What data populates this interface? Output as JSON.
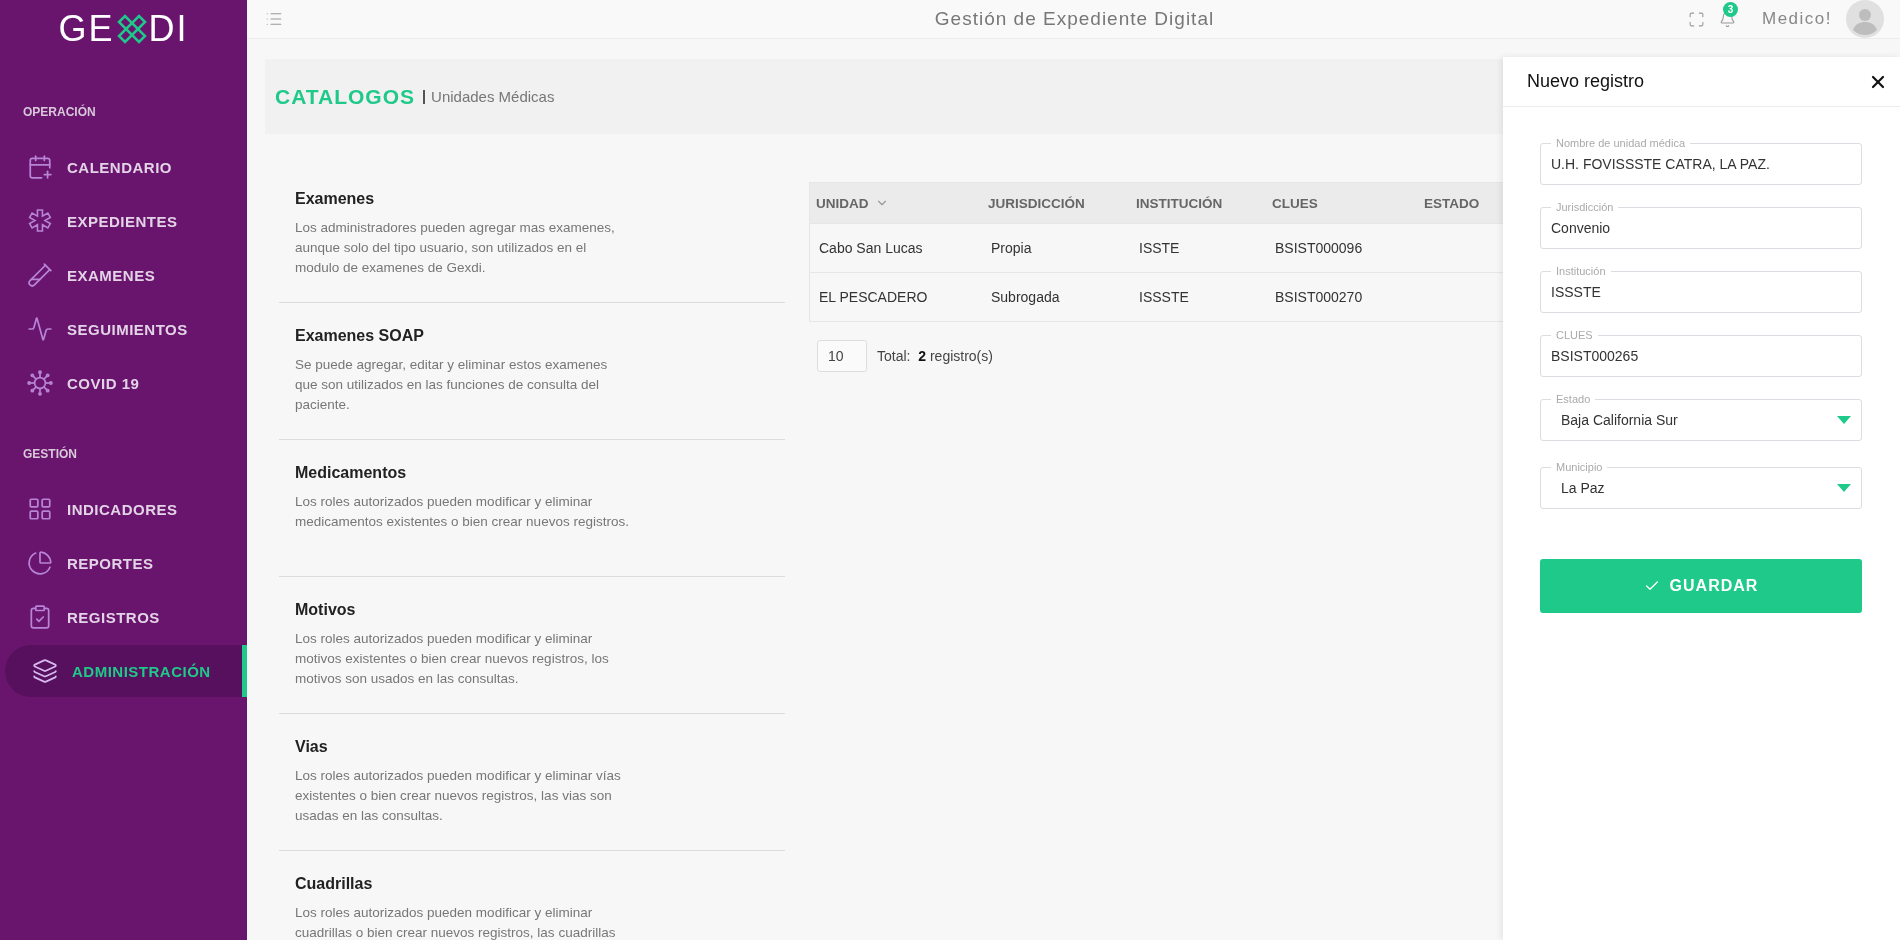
{
  "logo": {
    "left": "GE",
    "right": "DI"
  },
  "sidebar": {
    "sections": [
      {
        "title": "OPERACIÓN",
        "items": [
          {
            "label": "CALENDARIO",
            "selected": false
          },
          {
            "label": "EXPEDIENTES",
            "selected": false
          },
          {
            "label": "EXAMENES",
            "selected": false
          },
          {
            "label": "SEGUIMIENTOS",
            "selected": false
          },
          {
            "label": "COVID 19",
            "selected": false
          }
        ]
      },
      {
        "title": "GESTIÓN",
        "items": [
          {
            "label": "INDICADORES",
            "selected": false
          },
          {
            "label": "REPORTES",
            "selected": false
          },
          {
            "label": "REGISTROS",
            "selected": false
          },
          {
            "label": "ADMINISTRACIÓN",
            "selected": true
          }
        ]
      }
    ]
  },
  "header": {
    "title": "Gestión de Expediente Digital",
    "notifications": "3",
    "user": "Medico!"
  },
  "page": {
    "title": "CATALOGOS",
    "subtitle": "Unidades Médicas"
  },
  "catalogs": [
    {
      "name": "Examenes",
      "description": "Los administradores pueden agregar mas examenes, aunque solo del tipo usuario, son utilizados en el modulo de examenes de Gexdi."
    },
    {
      "name": "Examenes SOAP",
      "description": "Se puede agregar, editar y eliminar estos examenes que son utilizados en las funciones de consulta del paciente."
    },
    {
      "name": "Medicamentos",
      "description": "Los roles autorizados pueden modificar y eliminar medicamentos existentes o bien crear nuevos registros."
    },
    {
      "name": "Motivos",
      "description": "Los roles autorizados pueden modificar y eliminar motivos existentes o bien crear nuevos registros, los motivos son usados en las consultas."
    },
    {
      "name": "Vias",
      "description": "Los roles autorizados pueden modificar y eliminar vías existentes o bien crear nuevos registros, las vias son usadas en las consultas."
    },
    {
      "name": "Cuadrillas",
      "description": "Los roles autorizados pueden modificar y eliminar cuadrillas o bien crear nuevos registros, las cuadrillas"
    }
  ],
  "table": {
    "columns": [
      {
        "label": "UNIDAD",
        "sorted": true
      },
      {
        "label": "JURISDICCIÓN",
        "sorted": false
      },
      {
        "label": "INSTITUCIÓN",
        "sorted": false
      },
      {
        "label": "CLUES",
        "sorted": false
      },
      {
        "label": "ESTADO",
        "sorted": false
      }
    ],
    "rows": [
      [
        "Cabo San Lucas",
        "Propia",
        "ISSTE",
        "BSIST000096"
      ],
      [
        "EL PESCADERO",
        "Subrogada",
        "ISSSTE",
        "BSIST000270"
      ]
    ],
    "page_size": "10",
    "total": "Total:  **2** registro(s)"
  },
  "panel": {
    "title": "Nuevo registro",
    "fields": [
      {
        "kind": "text",
        "label": "Nombre de unidad médica",
        "value": "U.H. FOVISSSTE CATRA, LA PAZ."
      },
      {
        "kind": "text",
        "label": "Jurisdicción",
        "value": "Convenio"
      },
      {
        "kind": "text",
        "label": "Institución",
        "value": "ISSSTE"
      },
      {
        "kind": "text",
        "label": "CLUES",
        "value": "BSIST000265"
      },
      {
        "kind": "select",
        "label": "Estado",
        "value": "Baja California Sur"
      },
      {
        "kind": "select",
        "label": "Municipio",
        "value": "La Paz"
      }
    ],
    "submit": "GUARDAR"
  }
}
